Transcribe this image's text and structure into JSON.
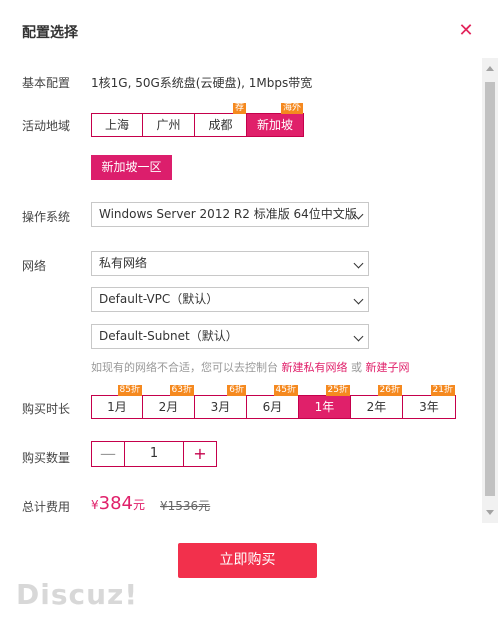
{
  "dialog": {
    "title": "配置选择",
    "close_icon": "close-icon"
  },
  "basic": {
    "label": "基本配置",
    "value": "1核1G, 50G系统盘(云硬盘), 1Mbps带宽"
  },
  "region": {
    "label": "活动地域",
    "options": [
      {
        "name": "上海",
        "tag": "",
        "selected": false
      },
      {
        "name": "广州",
        "tag": "",
        "selected": false
      },
      {
        "name": "成都",
        "tag": "荐",
        "selected": false
      },
      {
        "name": "新加坡",
        "tag": "海外",
        "selected": true
      }
    ],
    "zone": "新加坡一区"
  },
  "os": {
    "label": "操作系统",
    "value": "Windows Server 2012 R2 标准版 64位中文版"
  },
  "network": {
    "label": "网络",
    "type": "私有网络",
    "vpc": "Default-VPC（默认）",
    "subnet": "Default-Subnet（默认）",
    "hint": "如现有的网络不合适，您可以去控制台",
    "link_vpc": "新建私有网络",
    "or": "或",
    "link_subnet": "新建子网"
  },
  "duration": {
    "label": "购买时长",
    "options": [
      {
        "name": "1月",
        "tag": "85折",
        "selected": false
      },
      {
        "name": "2月",
        "tag": "63折",
        "selected": false
      },
      {
        "name": "3月",
        "tag": "6折",
        "selected": false
      },
      {
        "name": "6月",
        "tag": "45折",
        "selected": false
      },
      {
        "name": "1年",
        "tag": "25折",
        "selected": true
      },
      {
        "name": "2年",
        "tag": "26折",
        "selected": false
      },
      {
        "name": "3年",
        "tag": "21折",
        "selected": false
      }
    ]
  },
  "quantity": {
    "label": "购买数量",
    "minus": "—",
    "value": "1",
    "plus": "+"
  },
  "total": {
    "label": "总计费用",
    "currency": "¥",
    "price": "384",
    "unit": "元",
    "original": "¥1536元"
  },
  "buy_button": "立即购买",
  "watermark": "Discuz!"
}
